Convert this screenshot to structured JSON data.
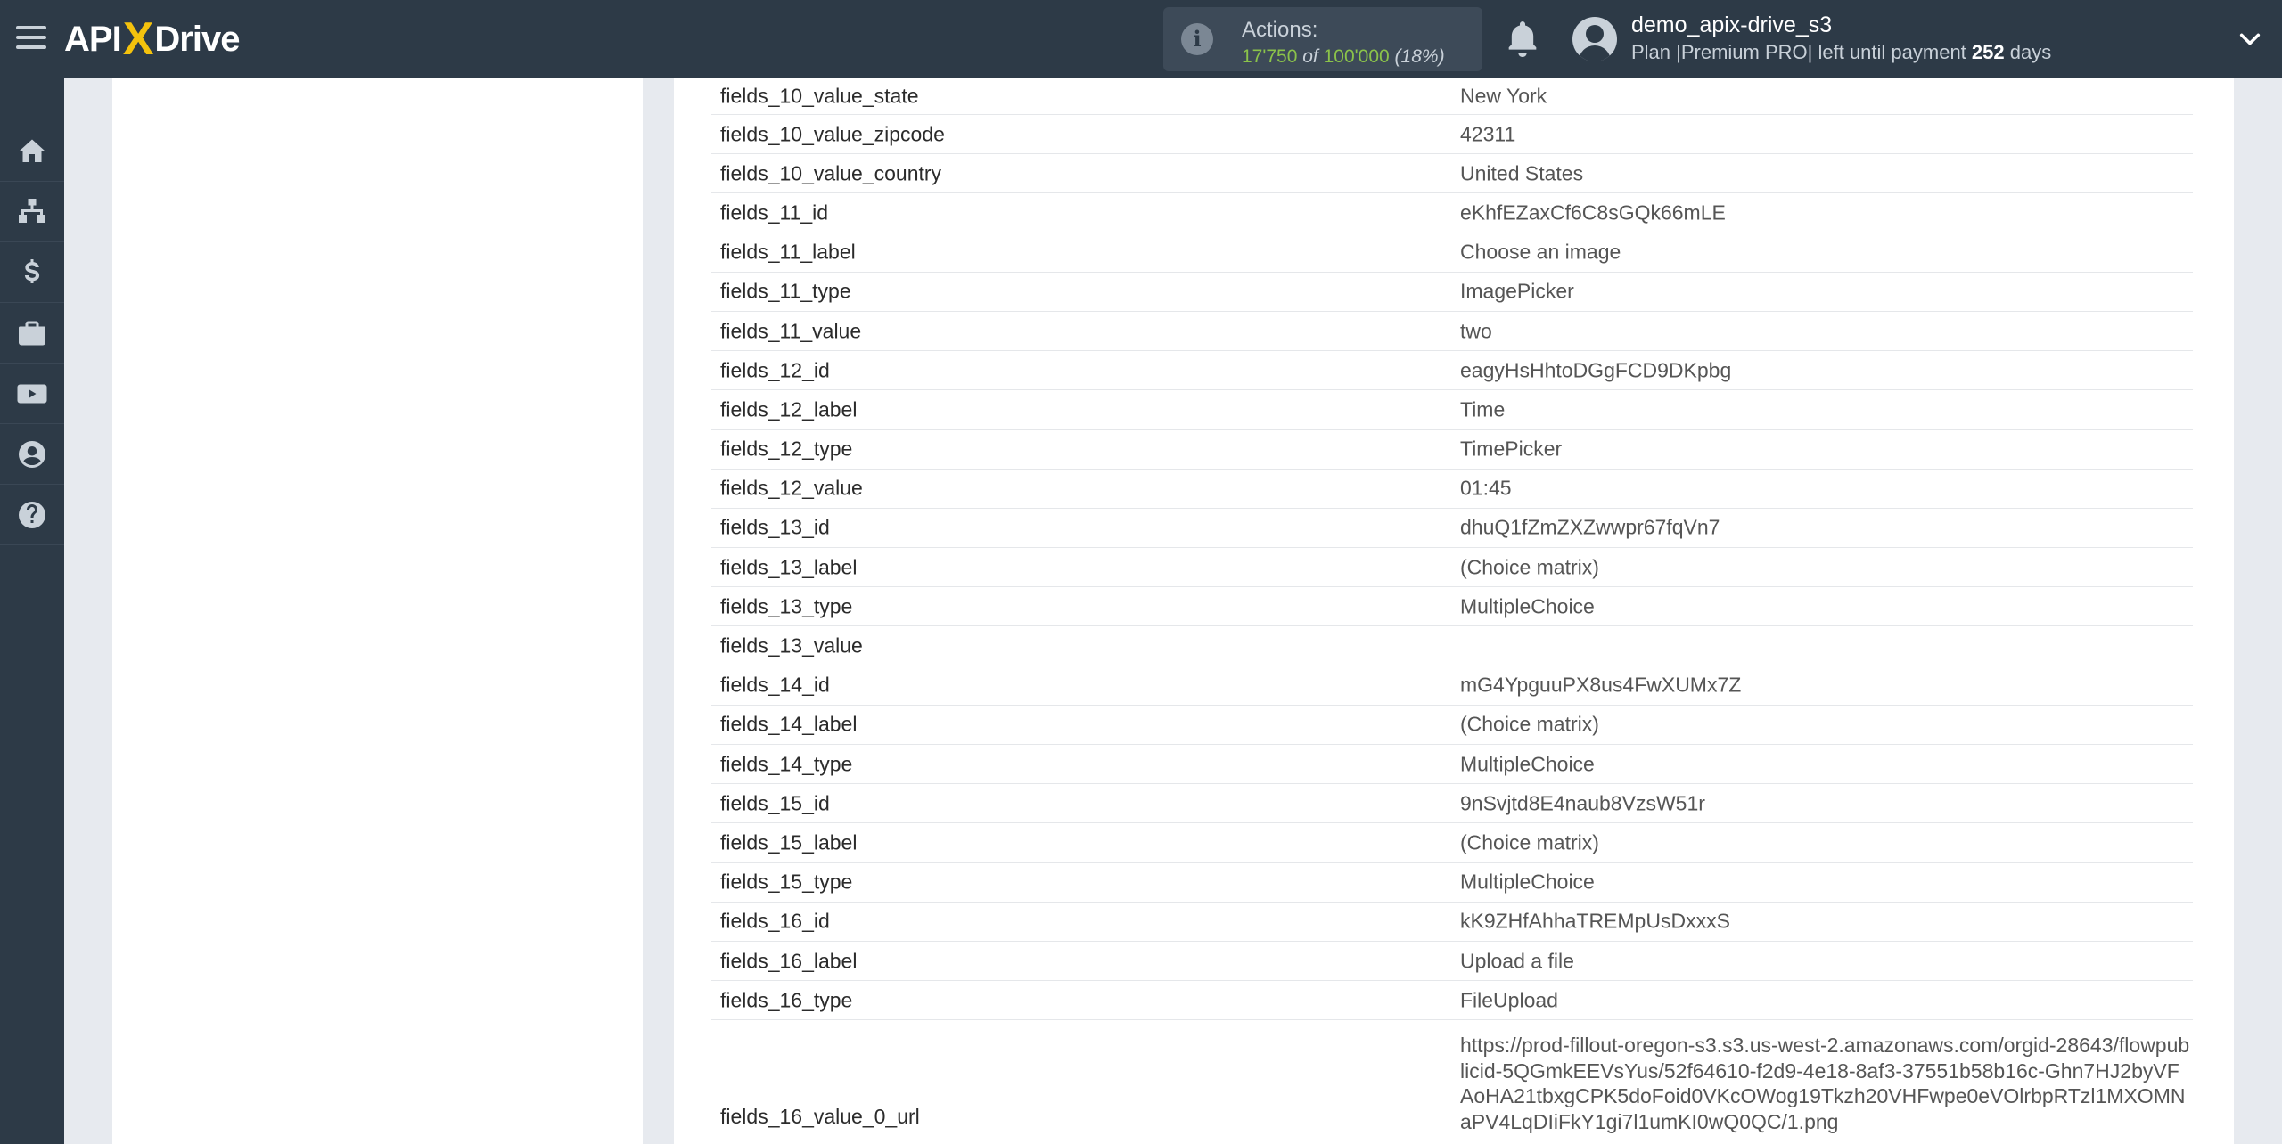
{
  "header": {
    "logo_left": "API",
    "logo_x": "X",
    "logo_right": "Drive",
    "actions_title": "Actions:",
    "actions_used": "17'750",
    "actions_of": "of",
    "actions_total": "100'000",
    "actions_pct": "(18%)",
    "username": "demo_apix-drive_s3",
    "plan_prefix": "Plan |Premium PRO| left until payment",
    "plan_days": "252",
    "plan_suffix": "days"
  },
  "sidebar": {
    "items": [
      {
        "icon": "home-icon"
      },
      {
        "icon": "sitemap-icon"
      },
      {
        "icon": "dollar-icon"
      },
      {
        "icon": "briefcase-icon"
      },
      {
        "icon": "youtube-icon"
      },
      {
        "icon": "user-circle-icon"
      },
      {
        "icon": "help-icon"
      }
    ]
  },
  "fields": [
    {
      "key": "fields_10_value_state",
      "value": "New York"
    },
    {
      "key": "fields_10_value_zipcode",
      "value": "42311"
    },
    {
      "key": "fields_10_value_country",
      "value": "United States"
    },
    {
      "key": "fields_11_id",
      "value": "eKhfEZaxCf6C8sGQk66mLE"
    },
    {
      "key": "fields_11_label",
      "value": "Choose an image"
    },
    {
      "key": "fields_11_type",
      "value": "ImagePicker"
    },
    {
      "key": "fields_11_value",
      "value": "two"
    },
    {
      "key": "fields_12_id",
      "value": "eagyHsHhtoDGgFCD9DKpbg"
    },
    {
      "key": "fields_12_label",
      "value": "Time"
    },
    {
      "key": "fields_12_type",
      "value": "TimePicker"
    },
    {
      "key": "fields_12_value",
      "value": "01:45"
    },
    {
      "key": "fields_13_id",
      "value": "dhuQ1fZmZXZwwpr67fqVn7"
    },
    {
      "key": "fields_13_label",
      "value": "(Choice matrix)"
    },
    {
      "key": "fields_13_type",
      "value": "MultipleChoice"
    },
    {
      "key": "fields_13_value",
      "value": ""
    },
    {
      "key": "fields_14_id",
      "value": "mG4YpguuPX8us4FwXUMx7Z"
    },
    {
      "key": "fields_14_label",
      "value": "(Choice matrix)"
    },
    {
      "key": "fields_14_type",
      "value": "MultipleChoice"
    },
    {
      "key": "fields_15_id",
      "value": "9nSvjtd8E4naub8VzsW51r"
    },
    {
      "key": "fields_15_label",
      "value": "(Choice matrix)"
    },
    {
      "key": "fields_15_type",
      "value": "MultipleChoice"
    },
    {
      "key": "fields_16_id",
      "value": "kK9ZHfAhhaTREMpUsDxxxS"
    },
    {
      "key": "fields_16_label",
      "value": "Upload a file"
    },
    {
      "key": "fields_16_type",
      "value": "FileUpload"
    },
    {
      "key": "fields_16_value_0_url",
      "value": "https://prod-fillout-oregon-s3.s3.us-west-2.amazonaws.com/orgid-28643/flowpublicid-5QGmkEEVsYus/52f64610-f2d9-4e18-8af3-37551b58b16c-Ghn7HJ2byVFAoHA21tbxgCPK5doFoid0VKcOWog19Tkzh20VHFwpe0eVOlrbpRTzl1MXOMNaPV4LqDIiFkY1gi7l1umKI0wQ0QC/1.png"
    }
  ]
}
